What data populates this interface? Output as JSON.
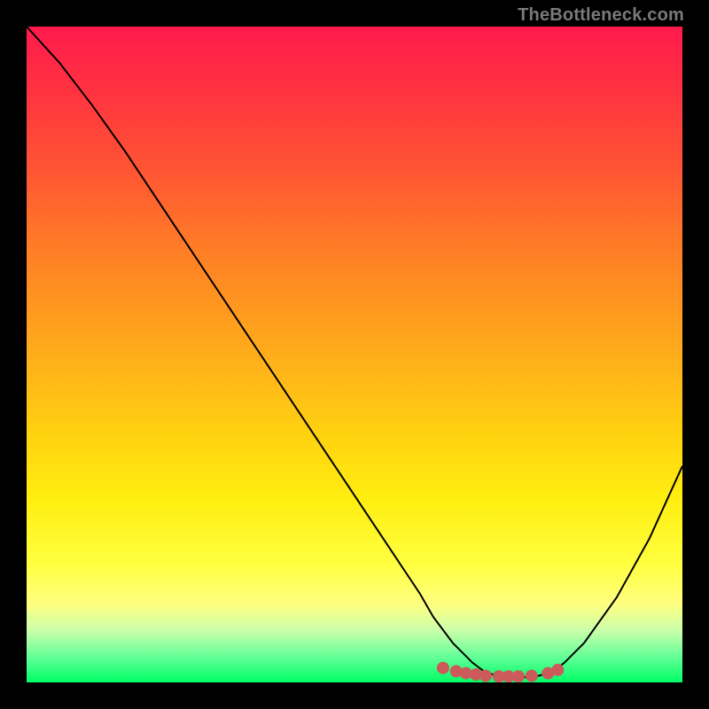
{
  "watermark": "TheBottleneck.com",
  "chart_data": {
    "type": "line",
    "title": "",
    "xlabel": "",
    "ylabel": "",
    "xlim": [
      0,
      100
    ],
    "ylim": [
      0,
      100
    ],
    "series": [
      {
        "name": "curve",
        "x": [
          0,
          5,
          10,
          15,
          20,
          25,
          30,
          35,
          40,
          45,
          50,
          55,
          60,
          62,
          65,
          68,
          70,
          72,
          74,
          76,
          78,
          80,
          82,
          85,
          90,
          95,
          100
        ],
        "y": [
          100,
          94.5,
          88,
          81,
          73.5,
          66,
          58.5,
          51,
          43.5,
          36,
          28.5,
          21,
          13.5,
          10,
          6,
          3,
          1.5,
          1,
          0.8,
          0.8,
          1,
          1.5,
          3,
          6,
          13,
          22,
          33
        ]
      }
    ],
    "markers": {
      "name": "highlight-dots",
      "x": [
        63.5,
        65.5,
        67,
        68.5,
        70,
        72,
        73.5,
        75,
        77,
        79.5,
        81
      ],
      "y": [
        2.2,
        1.7,
        1.4,
        1.2,
        1.0,
        0.9,
        0.9,
        0.9,
        1.0,
        1.4,
        1.9
      ],
      "color": "#cc5a5a",
      "radius": 7
    },
    "gradient_stops": [
      {
        "offset": 0,
        "color": "#ff1a4d"
      },
      {
        "offset": 10,
        "color": "#ff3340"
      },
      {
        "offset": 22,
        "color": "#ff5533"
      },
      {
        "offset": 32,
        "color": "#ff7728"
      },
      {
        "offset": 42,
        "color": "#ff9520"
      },
      {
        "offset": 52,
        "color": "#ffb31a"
      },
      {
        "offset": 62,
        "color": "#ffd110"
      },
      {
        "offset": 72,
        "color": "#ffee10"
      },
      {
        "offset": 82,
        "color": "#ffff40"
      },
      {
        "offset": 88,
        "color": "#ffff80"
      },
      {
        "offset": 92,
        "color": "#ccffaa"
      },
      {
        "offset": 96,
        "color": "#66ff99"
      },
      {
        "offset": 100,
        "color": "#00ff66"
      }
    ],
    "curve_color": "#000000",
    "curve_width": 2
  }
}
